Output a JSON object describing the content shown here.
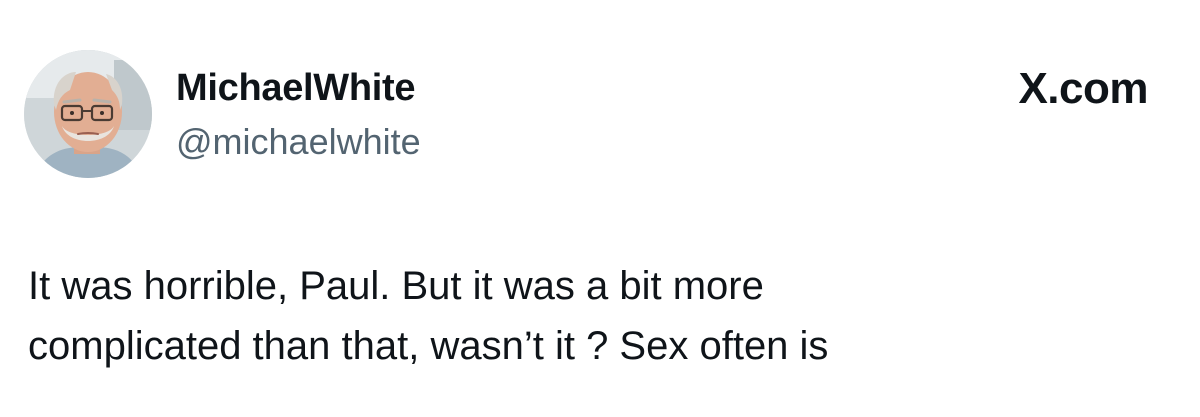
{
  "author": {
    "display_name": "MichaelWhite",
    "handle": "@michaelwhite",
    "avatar": "avatar-photo-older-man-with-glasses"
  },
  "brand": {
    "text": "X.com"
  },
  "tweet": {
    "lines": [
      "It was horrible, Paul. But it was a bit more",
      "complicated than that, wasn’t it ? Sex often is"
    ]
  },
  "colors": {
    "background": "#ffffff",
    "text_primary": "#0f1419",
    "text_secondary": "#536471"
  }
}
